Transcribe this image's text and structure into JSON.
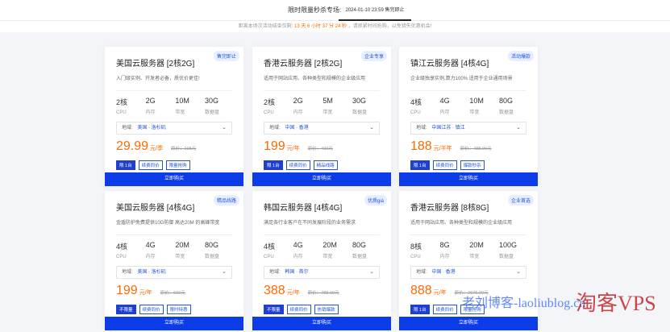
{
  "header": {
    "label": "限时限量秒杀专场:",
    "active_tab": "2024-01-10 23:59 售完即止"
  },
  "countdown": {
    "prefix": "距离本场次活动结束仅剩:",
    "time": "13 天 6 小时 37 分 24 秒",
    "suffix": "，请抓紧时间抢购，以免错失优惠机会!"
  },
  "buy_label": "立即购买",
  "region_label": "地域:",
  "spec_keys": [
    "CPU",
    "内存",
    "带宽",
    "数据盘"
  ],
  "cards": [
    {
      "title": "美国云服务器 [2核2G]",
      "badge": "售完即止",
      "desc": "入门级实例、开发者必备，质优价更佳!",
      "specs": [
        "2核",
        "2G",
        "10M",
        "30G"
      ],
      "region": "美国 · 洛杉矶",
      "price": "29.99",
      "unit": "元/季",
      "orig": "原价：105元",
      "tags": [
        "限 1台",
        "续费同价",
        "限量抢购"
      ]
    },
    {
      "title": "香港云服务器 [2核2G]",
      "badge": "企业专享",
      "desc": "适用于网站应用、各种类型和规模的企业级应用",
      "specs": [
        "2核",
        "2G",
        "5M",
        "30G"
      ],
      "region": "中国 · 香港",
      "price": "199",
      "unit": "元/年",
      "orig": "原价：409元",
      "tags": [
        "限 1台",
        "续费同价",
        "精品线路"
      ]
    },
    {
      "title": "镇江云服务器 [4核4G]",
      "badge": "活动爆款",
      "desc": "企业级独享实例,算力100% 适用于企业通用场景",
      "specs": [
        "4核",
        "4G",
        "10M",
        "80G"
      ],
      "region": "中国江苏 · 镇江",
      "price": "188",
      "unit": "元/半年",
      "orig": "原价：488.00元",
      "tags": [
        "限 1台",
        "续费同价",
        "爆款秒杀"
      ]
    },
    {
      "title": "美国云服务器 [4核4G]",
      "badge": "精品线路",
      "desc": "金盾防护免费提供10G防御 高达20M 的高峰带宽",
      "specs": [
        "4核",
        "4G",
        "20M",
        "80G"
      ],
      "region": "美国 · 洛杉矶",
      "price": "199",
      "unit": "元/年",
      "orig": "原价：660元",
      "tags": [
        "不限量",
        "续费同价",
        "限时特惠"
      ]
    },
    {
      "title": "韩国云服务器 [4核4G]",
      "badge": "优质giá",
      "desc": "满足各行业客户在不同发展阶段的业务需求",
      "specs": [
        "4核",
        "4G",
        "20M",
        "80G"
      ],
      "region": "韩国 · 首尔",
      "price": "388",
      "unit": "元/年",
      "orig": "原价：788.00元",
      "tags": [
        "不限量",
        "续费同价",
        "热销爆款"
      ]
    },
    {
      "title": "香港云服务器 [8核8G]",
      "badge": "企业首选",
      "desc": "适用于网站应用、各种类型和规模的企业级应用",
      "specs": [
        "8核",
        "8G",
        "20M",
        "100G"
      ],
      "region": "中国 · 香港",
      "price": "888",
      "unit": "元/年",
      "orig": "原价：2976.00元",
      "tags": [
        "限 1台",
        "续费同价",
        "限量抢购"
      ]
    }
  ],
  "watermark": "老刘博客-laoliublog.cn",
  "watermark2": "淘客VPS",
  "colors": {
    "accent": "#ff6a00",
    "brand": "#0c3be8",
    "badge_bg": "#e7eeff"
  },
  "icons": {
    "dropdown": "chevron-down-icon"
  }
}
